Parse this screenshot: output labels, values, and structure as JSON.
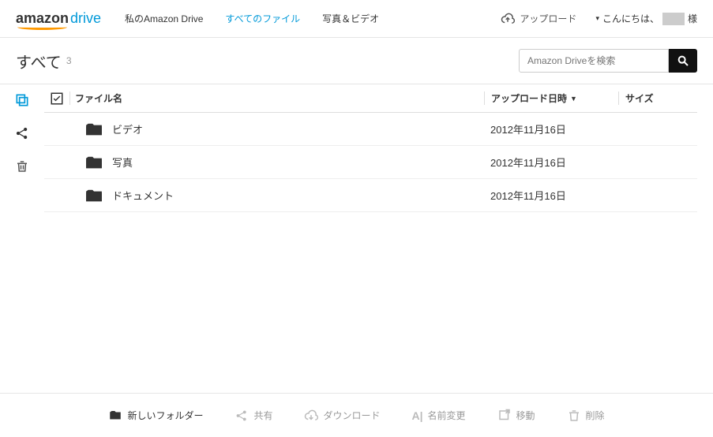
{
  "header": {
    "logo_amazon": "amazon",
    "logo_drive": "drive",
    "nav": [
      {
        "label": "私のAmazon Drive",
        "active": false
      },
      {
        "label": "すべてのファイル",
        "active": true
      },
      {
        "label": "写真＆ビデオ",
        "active": false
      }
    ],
    "upload_label": "アップロード",
    "greeting_prefix": "こんにちは、",
    "greeting_suffix": "様"
  },
  "subheader": {
    "title": "すべて",
    "count": "3",
    "search_placeholder": "Amazon Driveを検索"
  },
  "table": {
    "columns": {
      "name": "ファイル名",
      "date": "アップロード日時",
      "size": "サイズ"
    },
    "rows": [
      {
        "name": "ビデオ",
        "date": "2012年11月16日",
        "size": ""
      },
      {
        "name": "写真",
        "date": "2012年11月16日",
        "size": ""
      },
      {
        "name": "ドキュメント",
        "date": "2012年11月16日",
        "size": ""
      }
    ]
  },
  "toolbar": {
    "new_folder": "新しいフォルダー",
    "share": "共有",
    "download": "ダウンロード",
    "rename": "名前変更",
    "move": "移動",
    "delete": "削除"
  }
}
